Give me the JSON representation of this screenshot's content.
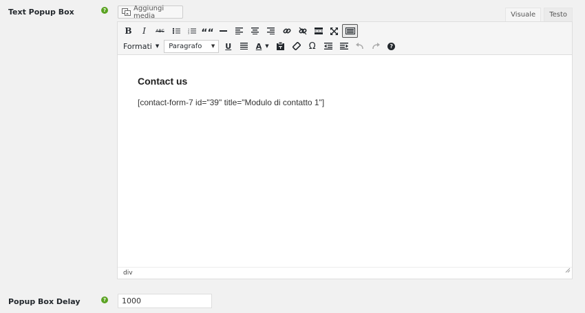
{
  "fields": {
    "text_popup_label": "Text Popup Box",
    "help_glyph": "?",
    "delay_label": "Popup Box Delay",
    "delay_value": "1000"
  },
  "editor": {
    "add_media_label": "Aggiungi media",
    "tabs": {
      "visual": "Visuale",
      "text": "Testo"
    },
    "formats_label": "Formati",
    "paragraph_select": "Paragrafo",
    "heading": "Contact us",
    "shortcode": "[contact-form-7 id=\"39\" title=\"Modulo di contatto 1\"]",
    "status_path": "div"
  },
  "toolbar_icons": {
    "bold": "B",
    "italic": "I",
    "strike": "ABC",
    "blockquote": "““",
    "underline": "U",
    "text_color": "A",
    "omega": "Ω",
    "help": "?"
  },
  "colors": {
    "help_green": "#5aa321",
    "background": "#f1f1f1"
  }
}
